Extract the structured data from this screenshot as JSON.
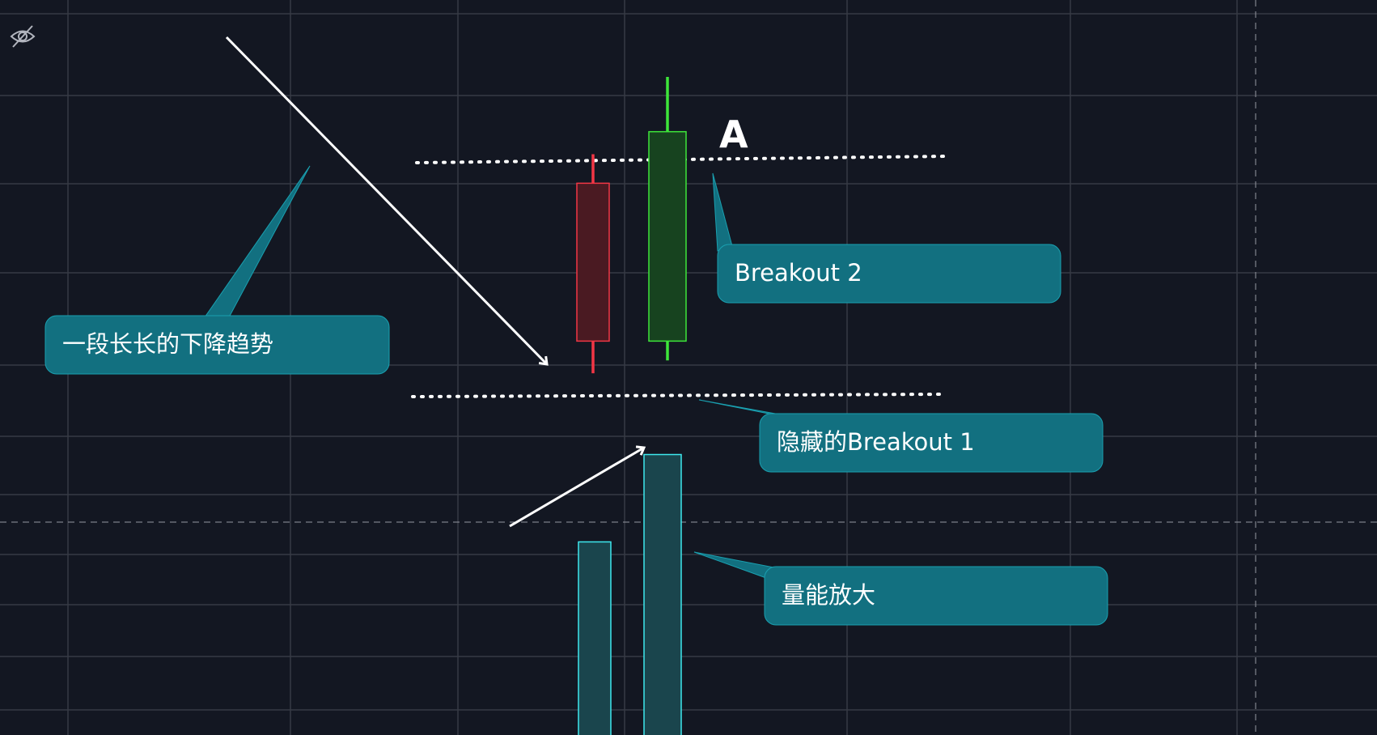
{
  "colors": {
    "background": "#131722",
    "grid": "#363a45",
    "crosshair": "#9598a1",
    "bear": "#f23645",
    "bear_body": "#4a1a22",
    "bull": "#3ee63a",
    "bull_body": "#17431f",
    "volume_stroke": "#3ee8ee",
    "volume_fill": "#1a454d",
    "callout_fill": "#127080",
    "callout_stroke": "#1aa0b0",
    "annotation": "#ffffff"
  },
  "toolbar": {
    "visibility_icon": "eye-off-icon"
  },
  "annotations": {
    "point_label": "A",
    "callout_trend": "一段长长的下降趋势",
    "callout_breakout2": "Breakout 2",
    "callout_breakout1": "隐藏的Breakout 1",
    "callout_volume": "量能放大"
  },
  "chart_data": {
    "type": "candlestick",
    "price_range": {
      "min": 0,
      "max": 100
    },
    "volume_range": {
      "min": 0,
      "max": 100
    },
    "candles": [
      {
        "direction": "down",
        "open": 68,
        "close": 19,
        "high": 77,
        "low": 9
      },
      {
        "direction": "up",
        "open": 19,
        "close": 84,
        "high": 101,
        "low": 13
      }
    ],
    "volume": [
      42,
      61
    ],
    "levels": [
      {
        "name": "resistance",
        "value": 77
      },
      {
        "name": "support",
        "value": 9
      }
    ],
    "grid": true
  }
}
